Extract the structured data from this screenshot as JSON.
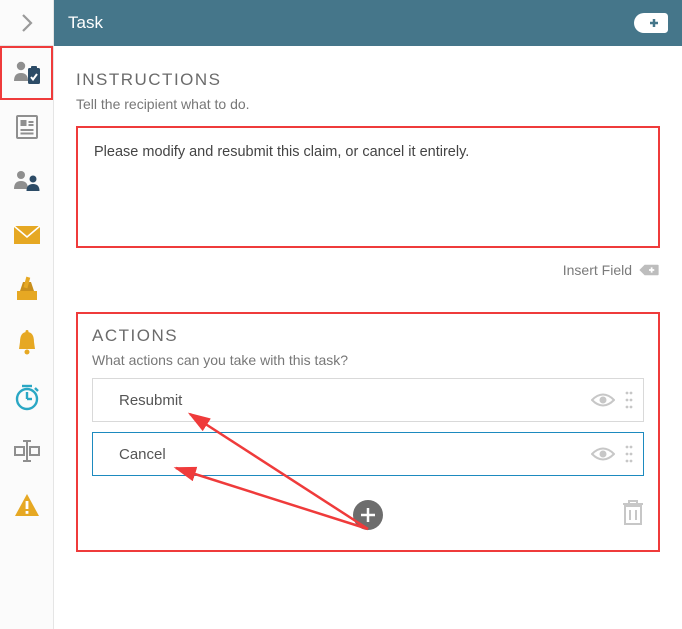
{
  "header": {
    "title": "Task"
  },
  "instructions": {
    "heading": "INSTRUCTIONS",
    "sub": "Tell the recipient what to do.",
    "body": "Please modify and resubmit this claim, or cancel it entirely.",
    "insert_field": "Insert Field"
  },
  "actions": {
    "heading": "ACTIONS",
    "sub": "What actions can you take with this task?",
    "items": [
      {
        "label": "Resubmit",
        "selected": false
      },
      {
        "label": "Cancel",
        "selected": true
      }
    ]
  },
  "sidebar": {
    "items": [
      {
        "name": "task-icon",
        "highlighted": true
      },
      {
        "name": "form-icon",
        "highlighted": false
      },
      {
        "name": "team-icon",
        "highlighted": false
      },
      {
        "name": "mail-icon",
        "highlighted": false
      },
      {
        "name": "ballot-icon",
        "highlighted": false
      },
      {
        "name": "bell-icon",
        "highlighted": false
      },
      {
        "name": "timer-icon",
        "highlighted": false
      },
      {
        "name": "cursor-icon",
        "highlighted": false
      },
      {
        "name": "warning-icon",
        "highlighted": false
      }
    ]
  },
  "colors": {
    "header_bg": "#45768a",
    "highlight": "#ef3b3b",
    "select_border": "#1d8abf",
    "amber": "#e6a823",
    "teal": "#2aa7c4",
    "navy": "#2c4b66",
    "gray": "#8f8f8f"
  }
}
